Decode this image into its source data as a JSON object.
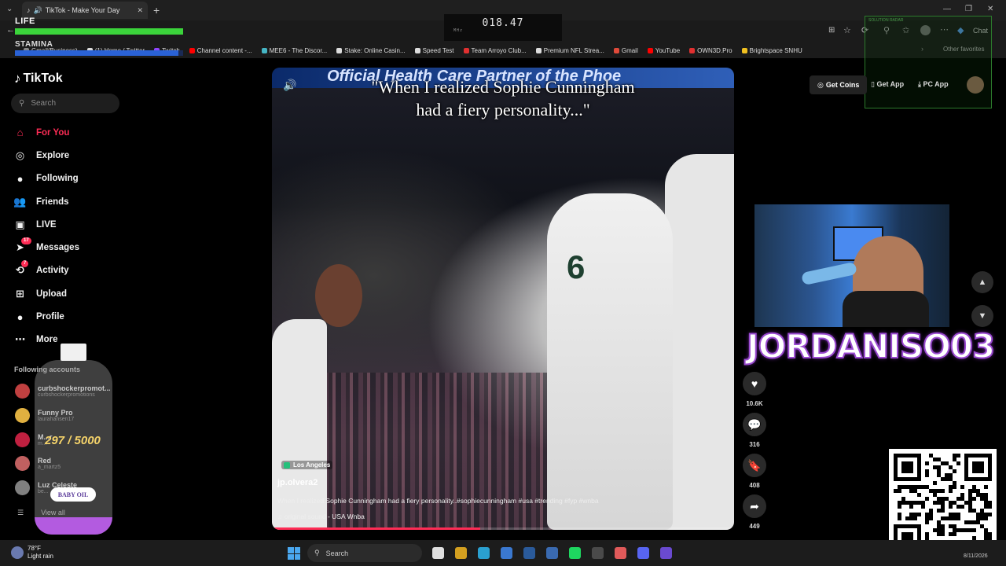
{
  "browser": {
    "tab_title": "TikTok - Make Your Day",
    "window_controls": [
      "—",
      "❐",
      "✕"
    ],
    "address_right": {
      "chat": "Chat"
    },
    "bookmarks": [
      {
        "label": "Gmail(Business)",
        "color": "#888888"
      },
      {
        "label": "(1) Home / Twitter",
        "color": "#dddddd"
      },
      {
        "label": "Twitch",
        "color": "#9146ff"
      },
      {
        "label": "Channel content -...",
        "color": "#ff0000"
      },
      {
        "label": "MEE6 - The Discor...",
        "color": "#45b5c4"
      },
      {
        "label": "Stake: Online Casin...",
        "color": "#dddddd"
      },
      {
        "label": "Speed Test",
        "color": "#dddddd"
      },
      {
        "label": "Team Arroyo Club...",
        "color": "#e03030"
      },
      {
        "label": "Premium NFL Strea...",
        "color": "#dddddd"
      },
      {
        "label": "Gmail",
        "color": "#e04a3a"
      },
      {
        "label": "YouTube",
        "color": "#ff0000"
      },
      {
        "label": "OWN3D.Pro",
        "color": "#e03030"
      },
      {
        "label": "Brightspace SNHU",
        "color": "#f0c020"
      }
    ],
    "other_favorites": "Other favorites"
  },
  "overlay": {
    "life_label": "LIFE",
    "life_level": 1.0,
    "stamina_label": "STAMINA",
    "stamina_level": 0.97,
    "timer": "018.47",
    "timer_sub": "MHz",
    "hud_text": "SOLUTION RADAR",
    "bottle_count": "297 / 5000",
    "bottle_label": "BABY OIL",
    "streamer_name": "JORDANISO03"
  },
  "tiktok": {
    "logo": "TikTok",
    "search_placeholder": "Search",
    "nav": [
      {
        "label": "For You",
        "icon": "home-icon",
        "active": true
      },
      {
        "label": "Explore",
        "icon": "compass-icon"
      },
      {
        "label": "Following",
        "icon": "following-avatar-icon"
      },
      {
        "label": "Friends",
        "icon": "friends-icon"
      },
      {
        "label": "LIVE",
        "icon": "live-icon"
      },
      {
        "label": "Messages",
        "icon": "messages-icon",
        "badge": "17"
      },
      {
        "label": "Activity",
        "icon": "activity-icon",
        "badge": "7"
      },
      {
        "label": "Upload",
        "icon": "upload-icon"
      },
      {
        "label": "Profile",
        "icon": "profile-avatar-icon"
      },
      {
        "label": "More",
        "icon": "more-icon"
      }
    ],
    "following_title": "Following accounts",
    "accounts": [
      {
        "name": "curbshockerpromot...",
        "handle": "curbshockerpromotions",
        "color": "#c04040"
      },
      {
        "name": "Funny Pro",
        "handle": "laurahansen17",
        "color": "#e0b040"
      },
      {
        "name": "M...r",
        "handle": "m...",
        "color": "#c02040"
      },
      {
        "name": "Red",
        "handle": "a_martz5",
        "color": "#c06060"
      },
      {
        "name": "Luz Celeste",
        "handle": "be...",
        "color": "#808080"
      }
    ],
    "view_all": "View all",
    "get_coins": "Get Coins",
    "get_app": "Get App",
    "pc_app": "PC App"
  },
  "video": {
    "banner_text": "Official Health Care Partner of the Phoe",
    "caption_line1": "\"When I realized Sophie Cunningham",
    "caption_line2": "had a fiery personality...\"",
    "jersey_number": "6",
    "location": "Los Angeles",
    "author": "jp.olvera2",
    "description": "When I realized Sophie Cunningham had a fiery personality..#sophiecunningham #usa #trending #fyp #wnba",
    "sound": "original sound - USA Wnba",
    "progress": 0.45,
    "likes": "10.6K",
    "comments": "316",
    "saves": "408",
    "shares": "449"
  },
  "taskbar": {
    "temp": "78°F",
    "weather": "Light rain",
    "search": "Search",
    "date": "8/11/2026",
    "icon_colors": [
      "#e0e0e0",
      "#d4a020",
      "#2aa0d0",
      "#3a78d0",
      "#2a5a9a",
      "#3a6ab0",
      "#1ed760",
      "#4a4a4a",
      "#e05a5a",
      "#5865f2",
      "#6a4ad0"
    ]
  }
}
